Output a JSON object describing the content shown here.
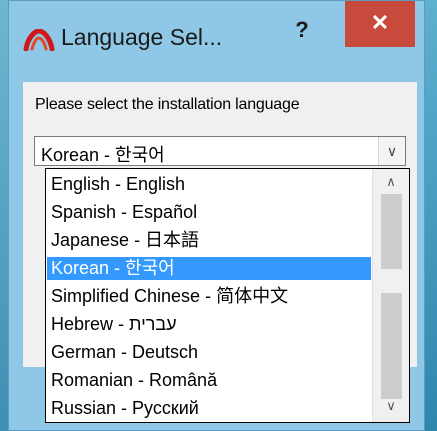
{
  "window": {
    "title": "Language Sel...",
    "help_label": "?",
    "close_label": "✕",
    "icon": "installer-logo-icon"
  },
  "prompt": "Please select the installation language",
  "combo": {
    "selected": "Korean - 한국어",
    "arrow_icon": "chevron-down-icon"
  },
  "list": {
    "items": [
      "English - English",
      "Spanish - Español",
      "Japanese - 日本語",
      "Korean - 한국어",
      "Simplified Chinese - 简体中文",
      "Hebrew - עברית",
      "German - Deutsch",
      "Romanian - Română",
      "Russian - Русский"
    ],
    "selected_index": 3
  },
  "colors": {
    "selection": "#3399ff",
    "close_button": "#c74a3c",
    "title_bar": "#8fc7e6"
  }
}
